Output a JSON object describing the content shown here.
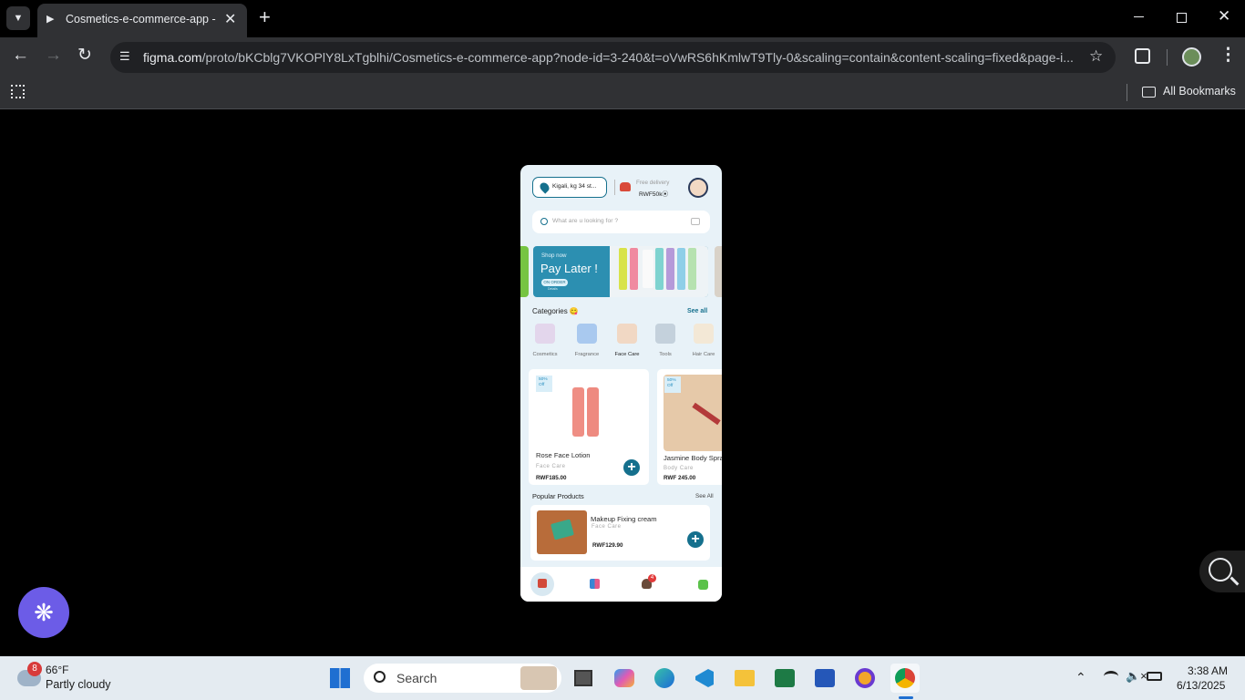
{
  "browser": {
    "tab_title": "Cosmetics-e-commerce-app - c",
    "url_domain": "figma.com",
    "url_path": "/proto/bKCblg7VKOPlY8LxTgblhi/Cosmetics-e-commerce-app?node-id=3-240&t=oVwRS6hKmlwT9Tly-0&scaling=contain&content-scaling=fixed&page-i...",
    "bookmarks_label": "All Bookmarks"
  },
  "app": {
    "location": "Kigali, kg 34 st...",
    "delivery_label": "Free delivery",
    "delivery_value": "RWF50k⦿",
    "search_placeholder": "What are u looking for ?",
    "banner": {
      "small": "Shop now",
      "title": "Pay Later !",
      "button": "ON ORDER",
      "tiny": "Details"
    },
    "categories_title": "Categories 😋",
    "see_all": "See all",
    "categories": [
      {
        "label": "Cosmetics"
      },
      {
        "label": "Fragrance"
      },
      {
        "label": "Face Care"
      },
      {
        "label": "Tools"
      },
      {
        "label": "Hair Care"
      }
    ],
    "products": [
      {
        "discount": "50%\nOff",
        "name": "Rose Face Lotion",
        "category": "Face Care",
        "price": "RWF185.00"
      },
      {
        "discount": "50%\nOff",
        "name": "Jasmine Body Spray",
        "category": "Body Care",
        "price": "RWF 245.00"
      }
    ],
    "popular_title": "Popular Products",
    "popular_see_all": "See All",
    "popular": {
      "name": "Makeup Fixing cream",
      "category": "Face Care",
      "price": "RWF129.90"
    },
    "cart_badge": "4"
  },
  "taskbar": {
    "weather_badge": "8",
    "temp": "66°F",
    "condition": "Partly cloudy",
    "search_label": "Search",
    "time": "3:38 AM",
    "date": "6/13/2025"
  },
  "colors": {
    "accent": "#15708d",
    "phone_bg": "#e8f2f8",
    "chrome": "#303134"
  }
}
